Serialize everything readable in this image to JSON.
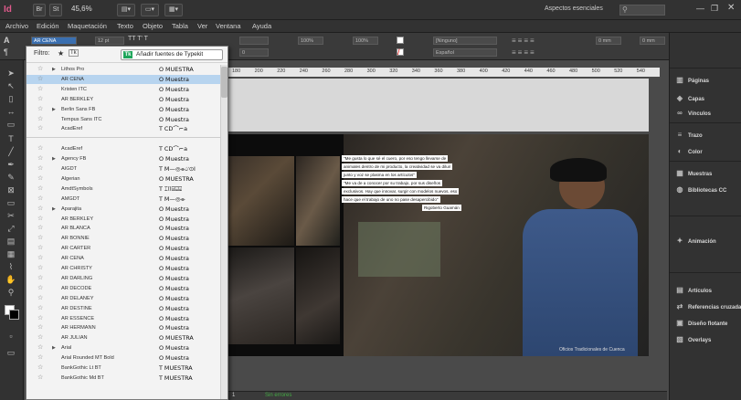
{
  "app": {
    "logo": "Id",
    "zoom": "45,6%",
    "workspace": "Aspectos esenciales",
    "search_placeholder": ""
  },
  "menu": [
    "Archivo",
    "Edición",
    "Maquetación",
    "Texto",
    "Objeto",
    "Tabla",
    "Ver",
    "Ventana",
    "Ayuda"
  ],
  "control": {
    "font_field": "AR CENA",
    "size": "12 pt",
    "lang": "Español",
    "mm1": "0 mm",
    "mm2": "0 mm",
    "pct1": "100%",
    "pct2": "100%",
    "track": "0",
    "none": "[Ninguno]"
  },
  "font_panel": {
    "filter_label": "Filtro:",
    "typekit_button": "Añadir fuentes de Typekit",
    "typekit_badge": "Tk",
    "rows": [
      {
        "name": "Lithos Pro",
        "arrow": true,
        "sample": "O MUESTRA"
      },
      {
        "name": "AR CENA",
        "arrow": false,
        "sample": "O Muestra",
        "selected": true
      },
      {
        "name": "Kristen ITC",
        "arrow": false,
        "sample": "O Muestra"
      },
      {
        "name": "AR BERKLEY",
        "arrow": false,
        "sample": "O Muestra"
      },
      {
        "name": "Berlin Sans FB",
        "arrow": true,
        "sample": "O Muestra"
      },
      {
        "name": "Tempus Sans ITC",
        "arrow": false,
        "sample": "O Muestra"
      },
      {
        "name": "AcadEref",
        "arrow": false,
        "sample": "T CD⌒⌐a"
      },
      {
        "name": "",
        "arrow": false,
        "sample": ""
      },
      {
        "name": "AcadEref",
        "arrow": false,
        "sample": "T CD⌒⌐a"
      },
      {
        "name": "Agency FB",
        "arrow": true,
        "sample": "O Muestra"
      },
      {
        "name": "AIGDT",
        "arrow": false,
        "sample": "T M—◎⌯⌰⊙I"
      },
      {
        "name": "Algerian",
        "arrow": false,
        "sample": "O MUESTRA"
      },
      {
        "name": "AmdtSymbols",
        "arrow": false,
        "sample": "T ⌶⌷⌸⌹⌺"
      },
      {
        "name": "AMGDT",
        "arrow": false,
        "sample": "T M—◎⌯"
      },
      {
        "name": "Aparajita",
        "arrow": true,
        "sample": "O Muestra"
      },
      {
        "name": "AR BERKLEY",
        "arrow": false,
        "sample": "O Muestra"
      },
      {
        "name": "AR BLANCA",
        "arrow": false,
        "sample": "O Muestra"
      },
      {
        "name": "AR BONNIE",
        "arrow": false,
        "sample": "O Muestra"
      },
      {
        "name": "AR CARTER",
        "arrow": false,
        "sample": "O Muestra"
      },
      {
        "name": "AR CENA",
        "arrow": false,
        "sample": "O Muestra"
      },
      {
        "name": "AR CHRISTY",
        "arrow": false,
        "sample": "O Muestra"
      },
      {
        "name": "AR DARLING",
        "arrow": false,
        "sample": "O Muestra"
      },
      {
        "name": "AR DECODE",
        "arrow": false,
        "sample": "O Muestra"
      },
      {
        "name": "AR DELANEY",
        "arrow": false,
        "sample": "O Muestra"
      },
      {
        "name": "AR DESTINE",
        "arrow": false,
        "sample": "O Muestra"
      },
      {
        "name": "AR ESSENCE",
        "arrow": false,
        "sample": "O Muestra"
      },
      {
        "name": "AR HERMANN",
        "arrow": false,
        "sample": "O Muestra"
      },
      {
        "name": "AR JULIAN",
        "arrow": false,
        "sample": "O MUESTRA"
      },
      {
        "name": "Arial",
        "arrow": true,
        "sample": "O Muestra"
      },
      {
        "name": "Arial Rounded MT Bold",
        "arrow": false,
        "sample": "O Muestra"
      },
      {
        "name": "BankGothic Lt BT",
        "arrow": false,
        "sample": "T MUESTRA"
      },
      {
        "name": "BankGothic Md BT",
        "arrow": false,
        "sample": "T MUESTRA"
      }
    ]
  },
  "ruler": [
    "180",
    "200",
    "220",
    "240",
    "260",
    "280",
    "300",
    "320",
    "340",
    "360",
    "380",
    "400",
    "420",
    "440",
    "460",
    "480",
    "500",
    "520",
    "540"
  ],
  "quote": [
    "\"Me gusta lo que sé el cuero, por eso tengo llevarse de",
    "animales dentro de mi producto, la creatividad se va diluir",
    "junto y voz se plasma en los artículos\"",
    "\"Me va de a conocer por su trabajo, por sus diseños",
    "exclusivos. Hay que innovar, surgir con modelos nuevos, eso",
    "hace que el trabajo de uno no pase desapercibido\"",
    "Rigoberto Guamán"
  ],
  "caption": "Oficios Tradicionales de Cuenca",
  "right_panel": [
    {
      "icon": "pages-icon",
      "glyph": "▥",
      "label": "Páginas"
    },
    {
      "icon": "layers-icon",
      "glyph": "◈",
      "label": "Capas"
    },
    {
      "icon": "links-icon",
      "glyph": "∞",
      "label": "Vínculos"
    },
    {
      "icon": "stroke-icon",
      "glyph": "≡",
      "label": "Trazo"
    },
    {
      "icon": "color-icon",
      "glyph": "◐",
      "label": "Color"
    },
    {
      "icon": "swatches-icon",
      "glyph": "▦",
      "label": "Muestras"
    },
    {
      "icon": "cc-libraries-icon",
      "glyph": "◍",
      "label": "Bibliotecas CC"
    },
    {
      "icon": "animation-icon",
      "glyph": "✦",
      "label": "Animación"
    },
    {
      "icon": "articles-icon",
      "glyph": "▤",
      "label": "Artículos"
    },
    {
      "icon": "cross-references-icon",
      "glyph": "⇄",
      "label": "Referencias cruzadas"
    },
    {
      "icon": "floating-design-icon",
      "glyph": "▣",
      "label": "Diseño flotante"
    },
    {
      "icon": "overlays-icon",
      "glyph": "▧",
      "label": "Overlays"
    }
  ],
  "status": {
    "page": "1",
    "errors": "Sin errores"
  }
}
